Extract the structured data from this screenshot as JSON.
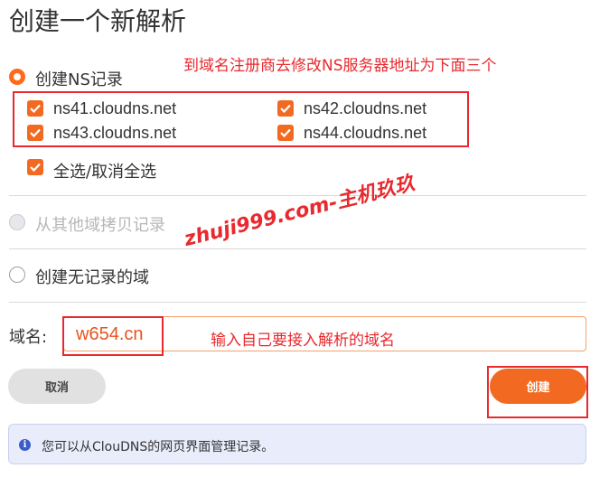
{
  "page": {
    "title": "创建一个新解析"
  },
  "annotations": {
    "ns_note": "到域名注册商去修改NS服务器地址为下面三个",
    "domain_note": "输入自己要接入解析的域名",
    "watermark": "zhuji999.com-主机玖玖"
  },
  "options": {
    "create_ns": "创建NS记录",
    "copy_from_other": "从其他域拷贝记录",
    "create_empty": "创建无记录的域"
  },
  "nameservers": [
    "ns41.cloudns.net",
    "ns42.cloudns.net",
    "ns43.cloudns.net",
    "ns44.cloudns.net"
  ],
  "select_all_label": "全选/取消全选",
  "domain_field": {
    "label": "域名:",
    "value": "w654.cn"
  },
  "buttons": {
    "cancel": "取消",
    "create": "创建"
  },
  "info": {
    "text": "您可以从ClouDNS的网页界面管理记录。"
  },
  "colors": {
    "accent": "#ff6a1a",
    "annotation_red": "#e8292e",
    "info_bg": "#e9edfb"
  }
}
